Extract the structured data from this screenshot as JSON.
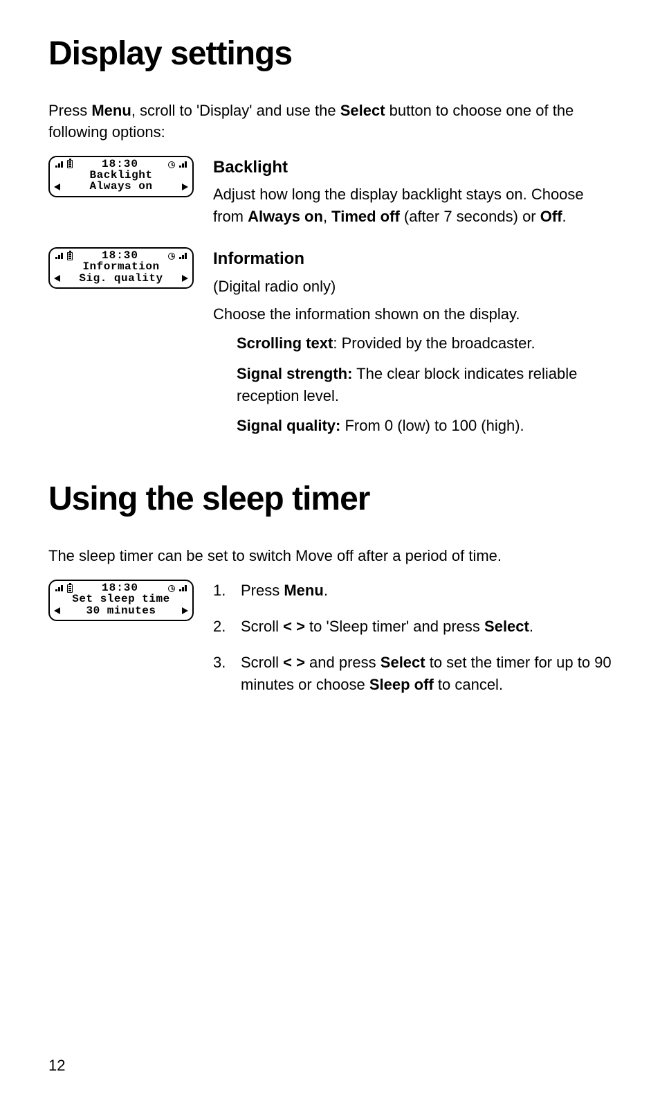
{
  "page_number": "12",
  "section1": {
    "title": "Display settings",
    "intro_pre": "Press ",
    "intro_b1": "Menu",
    "intro_mid": ", scroll to 'Display' and use the ",
    "intro_b2": "Select",
    "intro_post": " button to choose one of the following options:"
  },
  "lcd_common": {
    "time": "18:30"
  },
  "backlight": {
    "lcd_line1": "Backlight",
    "lcd_line2": "Always on",
    "heading": "Backlight",
    "p_pre": "Adjust how long the display backlight stays on. Choose from ",
    "opt1": "Always on",
    "sep1": ", ",
    "opt2": "Timed off",
    "p_mid": " (after 7 seconds) or ",
    "opt3": "Off",
    "p_end": "."
  },
  "information": {
    "lcd_line1": "Information",
    "lcd_line2": "Sig. quality",
    "heading": "Information",
    "note": "(Digital radio only)",
    "lead": "Choose the information shown on the display.",
    "i1_b": "Scrolling text",
    "i1_t": ": Provided by the broadcaster.",
    "i2_b": "Signal strength:",
    "i2_t": " The clear block indicates reliable reception level.",
    "i3_b": "Signal quality:",
    "i3_t": " From 0 (low) to 100 (high)."
  },
  "section2": {
    "title": "Using the sleep timer",
    "intro": "The sleep timer can be set to switch Move off after a period of time."
  },
  "sleep": {
    "lcd_line1": "Set sleep time",
    "lcd_line2": "30 minutes",
    "s1_pre": "Press ",
    "s1_b": "Menu",
    "s1_post": ".",
    "s2_pre": "Scroll ",
    "s2_b1": "< >",
    "s2_mid": " to 'Sleep timer' and press ",
    "s2_b2": "Select",
    "s2_post": ".",
    "s3_pre": "Scroll ",
    "s3_b1": "< >",
    "s3_mid1": " and press ",
    "s3_b2": "Select",
    "s3_mid2": " to set the timer for up to 90 minutes or choose ",
    "s3_b3": "Sleep off",
    "s3_post": " to cancel."
  }
}
